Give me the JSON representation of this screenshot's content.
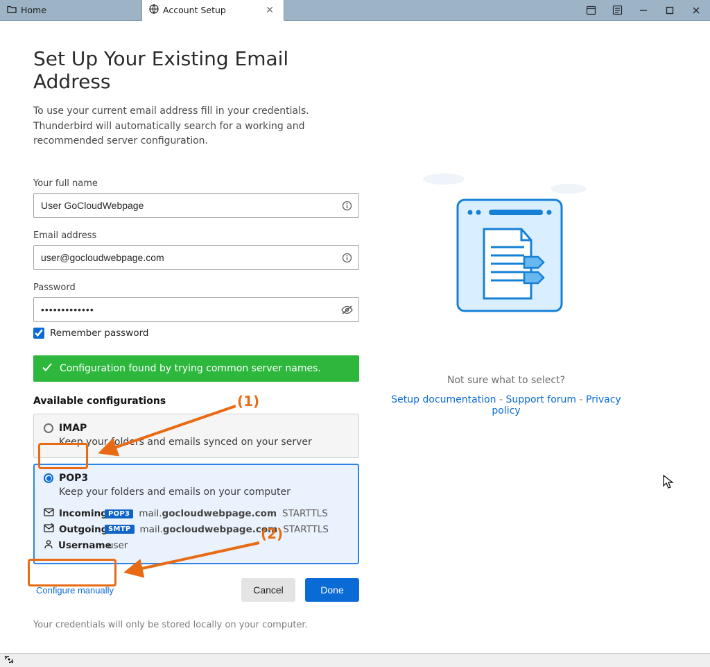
{
  "tabs": {
    "home": "Home",
    "setup": "Account Setup"
  },
  "title": "Set Up Your Existing Email Address",
  "subtitle": "To use your current email address fill in your credentials.\nThunderbird will automatically search for a working and recommended server configuration.",
  "form": {
    "name_label": "Your full name",
    "name_value": "User GoCloudWebpage",
    "email_label": "Email address",
    "email_value": "user@gocloudwebpage.com",
    "password_label": "Password",
    "password_value": "•••••••••••••",
    "remember_label": "Remember password"
  },
  "status": "Configuration found by trying common server names.",
  "available_heading": "Available configurations",
  "configs": {
    "imap": {
      "label": "IMAP",
      "desc": "Keep your folders and emails synced on your server"
    },
    "pop3": {
      "label": "POP3",
      "desc": "Keep your folders and emails on your computer",
      "incoming_label": "Incoming",
      "incoming_proto": "POP3",
      "incoming_server_pre": "mail.",
      "incoming_server_bold": "gocloudwebpage.com",
      "incoming_enc": "STARTTLS",
      "outgoing_label": "Outgoing",
      "outgoing_proto": "SMTP",
      "outgoing_server_pre": "mail.",
      "outgoing_server_bold": "gocloudwebpage.com",
      "outgoing_enc": "STARTTLS",
      "username_label": "Username",
      "username_value": "user"
    }
  },
  "actions": {
    "manual": "Configure manually",
    "cancel": "Cancel",
    "done": "Done"
  },
  "footnote": "Your credentials will only be stored locally on your computer.",
  "help": {
    "prompt": "Not sure what to select?",
    "doc": "Setup documentation",
    "forum": "Support forum",
    "privacy": "Privacy policy",
    "sep": " - "
  },
  "annotations": {
    "marker1": "(1)",
    "marker2": "(2)"
  }
}
